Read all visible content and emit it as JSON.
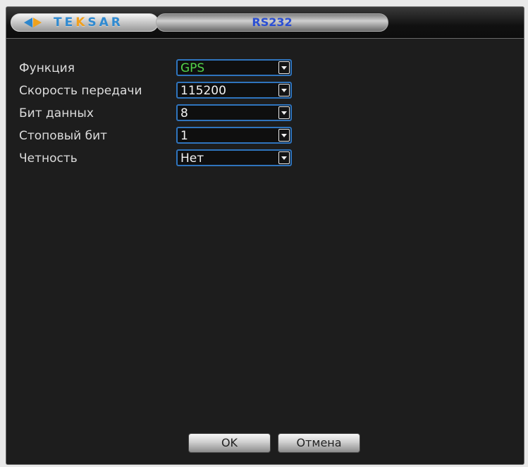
{
  "window": {
    "brand": {
      "logo_text_main": "TE",
      "logo_text_accent": "K",
      "logo_text_end": "SAR"
    },
    "title": "RS232"
  },
  "form": {
    "fields": [
      {
        "label": "Функция",
        "value": "GPS",
        "value_color": "#52d24a"
      },
      {
        "label": "Скорость передачи",
        "value": "115200",
        "value_color": "#f2f2f2"
      },
      {
        "label": "Бит данных",
        "value": "8",
        "value_color": "#f2f2f2"
      },
      {
        "label": "Стоповый бит",
        "value": "1",
        "value_color": "#f2f2f2"
      },
      {
        "label": "Четность",
        "value": "Нет",
        "value_color": "#f2f2f2"
      }
    ]
  },
  "footer": {
    "ok_label": "OK",
    "cancel_label": "Отмена"
  },
  "colors": {
    "border_blue": "#2f74bd",
    "title_blue": "#2b4fd4",
    "logo_blue": "#2f8ad1",
    "logo_orange": "#f2a01d"
  },
  "icons": {
    "logo": "teksar-arrows-icon",
    "dropdown": "chevron-down-icon"
  }
}
